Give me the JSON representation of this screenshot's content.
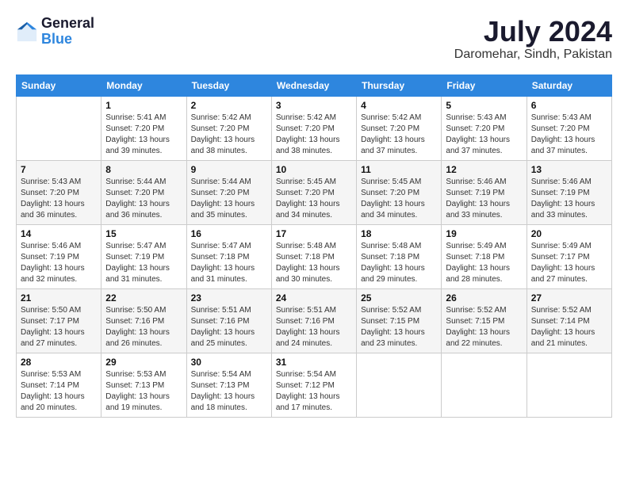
{
  "header": {
    "logo_line1": "General",
    "logo_line2": "Blue",
    "month_year": "July 2024",
    "location": "Daromehar, Sindh, Pakistan"
  },
  "days_of_week": [
    "Sunday",
    "Monday",
    "Tuesday",
    "Wednesday",
    "Thursday",
    "Friday",
    "Saturday"
  ],
  "weeks": [
    [
      {
        "day": "",
        "sunrise": "",
        "sunset": "",
        "daylight": ""
      },
      {
        "day": "1",
        "sunrise": "Sunrise: 5:41 AM",
        "sunset": "Sunset: 7:20 PM",
        "daylight": "Daylight: 13 hours and 39 minutes."
      },
      {
        "day": "2",
        "sunrise": "Sunrise: 5:42 AM",
        "sunset": "Sunset: 7:20 PM",
        "daylight": "Daylight: 13 hours and 38 minutes."
      },
      {
        "day": "3",
        "sunrise": "Sunrise: 5:42 AM",
        "sunset": "Sunset: 7:20 PM",
        "daylight": "Daylight: 13 hours and 38 minutes."
      },
      {
        "day": "4",
        "sunrise": "Sunrise: 5:42 AM",
        "sunset": "Sunset: 7:20 PM",
        "daylight": "Daylight: 13 hours and 37 minutes."
      },
      {
        "day": "5",
        "sunrise": "Sunrise: 5:43 AM",
        "sunset": "Sunset: 7:20 PM",
        "daylight": "Daylight: 13 hours and 37 minutes."
      },
      {
        "day": "6",
        "sunrise": "Sunrise: 5:43 AM",
        "sunset": "Sunset: 7:20 PM",
        "daylight": "Daylight: 13 hours and 37 minutes."
      }
    ],
    [
      {
        "day": "7",
        "sunrise": "Sunrise: 5:43 AM",
        "sunset": "Sunset: 7:20 PM",
        "daylight": "Daylight: 13 hours and 36 minutes."
      },
      {
        "day": "8",
        "sunrise": "Sunrise: 5:44 AM",
        "sunset": "Sunset: 7:20 PM",
        "daylight": "Daylight: 13 hours and 36 minutes."
      },
      {
        "day": "9",
        "sunrise": "Sunrise: 5:44 AM",
        "sunset": "Sunset: 7:20 PM",
        "daylight": "Daylight: 13 hours and 35 minutes."
      },
      {
        "day": "10",
        "sunrise": "Sunrise: 5:45 AM",
        "sunset": "Sunset: 7:20 PM",
        "daylight": "Daylight: 13 hours and 34 minutes."
      },
      {
        "day": "11",
        "sunrise": "Sunrise: 5:45 AM",
        "sunset": "Sunset: 7:20 PM",
        "daylight": "Daylight: 13 hours and 34 minutes."
      },
      {
        "day": "12",
        "sunrise": "Sunrise: 5:46 AM",
        "sunset": "Sunset: 7:19 PM",
        "daylight": "Daylight: 13 hours and 33 minutes."
      },
      {
        "day": "13",
        "sunrise": "Sunrise: 5:46 AM",
        "sunset": "Sunset: 7:19 PM",
        "daylight": "Daylight: 13 hours and 33 minutes."
      }
    ],
    [
      {
        "day": "14",
        "sunrise": "Sunrise: 5:46 AM",
        "sunset": "Sunset: 7:19 PM",
        "daylight": "Daylight: 13 hours and 32 minutes."
      },
      {
        "day": "15",
        "sunrise": "Sunrise: 5:47 AM",
        "sunset": "Sunset: 7:19 PM",
        "daylight": "Daylight: 13 hours and 31 minutes."
      },
      {
        "day": "16",
        "sunrise": "Sunrise: 5:47 AM",
        "sunset": "Sunset: 7:18 PM",
        "daylight": "Daylight: 13 hours and 31 minutes."
      },
      {
        "day": "17",
        "sunrise": "Sunrise: 5:48 AM",
        "sunset": "Sunset: 7:18 PM",
        "daylight": "Daylight: 13 hours and 30 minutes."
      },
      {
        "day": "18",
        "sunrise": "Sunrise: 5:48 AM",
        "sunset": "Sunset: 7:18 PM",
        "daylight": "Daylight: 13 hours and 29 minutes."
      },
      {
        "day": "19",
        "sunrise": "Sunrise: 5:49 AM",
        "sunset": "Sunset: 7:18 PM",
        "daylight": "Daylight: 13 hours and 28 minutes."
      },
      {
        "day": "20",
        "sunrise": "Sunrise: 5:49 AM",
        "sunset": "Sunset: 7:17 PM",
        "daylight": "Daylight: 13 hours and 27 minutes."
      }
    ],
    [
      {
        "day": "21",
        "sunrise": "Sunrise: 5:50 AM",
        "sunset": "Sunset: 7:17 PM",
        "daylight": "Daylight: 13 hours and 27 minutes."
      },
      {
        "day": "22",
        "sunrise": "Sunrise: 5:50 AM",
        "sunset": "Sunset: 7:16 PM",
        "daylight": "Daylight: 13 hours and 26 minutes."
      },
      {
        "day": "23",
        "sunrise": "Sunrise: 5:51 AM",
        "sunset": "Sunset: 7:16 PM",
        "daylight": "Daylight: 13 hours and 25 minutes."
      },
      {
        "day": "24",
        "sunrise": "Sunrise: 5:51 AM",
        "sunset": "Sunset: 7:16 PM",
        "daylight": "Daylight: 13 hours and 24 minutes."
      },
      {
        "day": "25",
        "sunrise": "Sunrise: 5:52 AM",
        "sunset": "Sunset: 7:15 PM",
        "daylight": "Daylight: 13 hours and 23 minutes."
      },
      {
        "day": "26",
        "sunrise": "Sunrise: 5:52 AM",
        "sunset": "Sunset: 7:15 PM",
        "daylight": "Daylight: 13 hours and 22 minutes."
      },
      {
        "day": "27",
        "sunrise": "Sunrise: 5:52 AM",
        "sunset": "Sunset: 7:14 PM",
        "daylight": "Daylight: 13 hours and 21 minutes."
      }
    ],
    [
      {
        "day": "28",
        "sunrise": "Sunrise: 5:53 AM",
        "sunset": "Sunset: 7:14 PM",
        "daylight": "Daylight: 13 hours and 20 minutes."
      },
      {
        "day": "29",
        "sunrise": "Sunrise: 5:53 AM",
        "sunset": "Sunset: 7:13 PM",
        "daylight": "Daylight: 13 hours and 19 minutes."
      },
      {
        "day": "30",
        "sunrise": "Sunrise: 5:54 AM",
        "sunset": "Sunset: 7:13 PM",
        "daylight": "Daylight: 13 hours and 18 minutes."
      },
      {
        "day": "31",
        "sunrise": "Sunrise: 5:54 AM",
        "sunset": "Sunset: 7:12 PM",
        "daylight": "Daylight: 13 hours and 17 minutes."
      },
      {
        "day": "",
        "sunrise": "",
        "sunset": "",
        "daylight": ""
      },
      {
        "day": "",
        "sunrise": "",
        "sunset": "",
        "daylight": ""
      },
      {
        "day": "",
        "sunrise": "",
        "sunset": "",
        "daylight": ""
      }
    ]
  ]
}
